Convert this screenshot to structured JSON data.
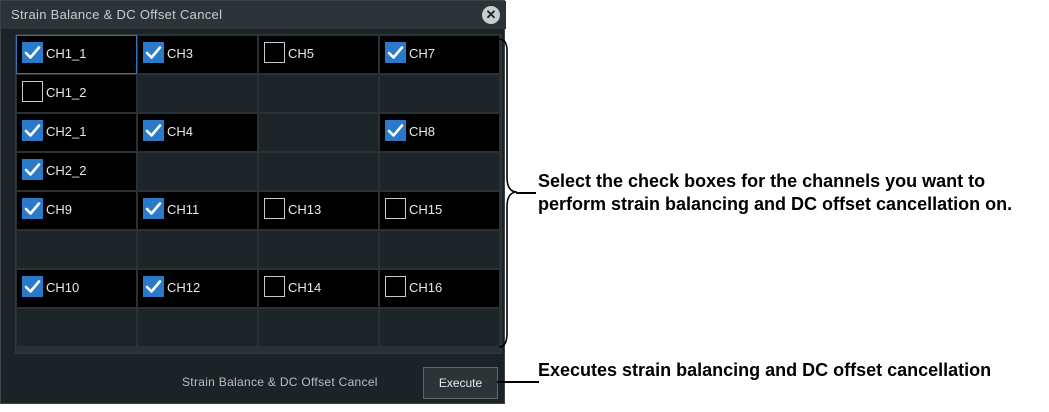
{
  "dialog": {
    "title": "Strain Balance & DC Offset Cancel",
    "close_icon": "close-icon"
  },
  "channels": [
    [
      {
        "label": "CH1_1",
        "checked": true
      },
      {
        "label": "CH3",
        "checked": true
      },
      {
        "label": "CH5",
        "checked": false
      },
      {
        "label": "CH7",
        "checked": true
      }
    ],
    [
      {
        "label": "CH1_2",
        "checked": false
      },
      null,
      null,
      null
    ],
    [
      {
        "label": "CH2_1",
        "checked": true
      },
      {
        "label": "CH4",
        "checked": true
      },
      null,
      {
        "label": "CH8",
        "checked": true
      }
    ],
    [
      {
        "label": "CH2_2",
        "checked": true
      },
      null,
      null,
      null
    ],
    [
      {
        "label": "CH9",
        "checked": true
      },
      {
        "label": "CH11",
        "checked": true
      },
      {
        "label": "CH13",
        "checked": false
      },
      {
        "label": "CH15",
        "checked": false
      }
    ],
    [
      null,
      null,
      null,
      null
    ],
    [
      {
        "label": "CH10",
        "checked": true
      },
      {
        "label": "CH12",
        "checked": true
      },
      {
        "label": "CH14",
        "checked": false
      },
      {
        "label": "CH16",
        "checked": false
      }
    ],
    [
      null,
      null,
      null,
      null
    ]
  ],
  "footer": {
    "label": "Strain Balance & DC Offset Cancel",
    "execute_label": "Execute"
  },
  "annotations": {
    "checkboxes": "Select the check boxes for the channels you want to perform strain balancing and DC offset cancellation on.",
    "execute": "Executes strain balancing and DC offset cancellation"
  },
  "colors": {
    "checkbox_checked": "#2a7ac9",
    "dialog_bg": "#1c2327",
    "focus_border": "#2e76b8"
  }
}
